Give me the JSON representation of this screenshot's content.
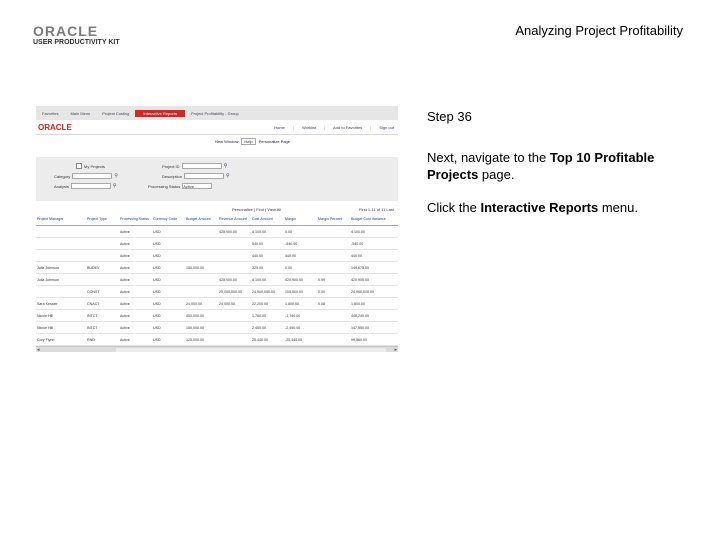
{
  "header": {
    "logo_oracle": "ORACLE",
    "logo_upk": "USER PRODUCTIVITY KIT",
    "title": "Analyzing Project Profitability"
  },
  "screenshot": {
    "nav": [
      "Favorites",
      "Main Menu",
      "Project Costing",
      "Interactive Reports",
      "Project Profitability - Group"
    ],
    "brand": "ORACLE",
    "toplinks": [
      "Home",
      "Worklist",
      "Add to Favorites",
      "Sign out"
    ],
    "ir_row": [
      "New Window",
      "Help",
      "Personalize Page"
    ],
    "filters": {
      "business_unit_label": "My Projects",
      "project_label": "Project ID",
      "category_label": "Category",
      "project_name_label": "Description",
      "analysis_label": "Analysis",
      "processing_status_label": "Processing Status",
      "processing_status_value": "Active"
    },
    "pager": {
      "left": "Personalize | Find | View All",
      "right": "First  1-11 of 11  Last"
    },
    "columns": [
      "Project Manager",
      "Project Type",
      "Processing Status",
      "Currency Code",
      "Budget Amount",
      "Revenue Amount",
      "Cost Amount",
      "Margin",
      "Margin Percent",
      "Budget Cost Variance"
    ],
    "rows": [
      [
        "",
        "",
        "Active",
        "USD",
        "",
        "425,000.00",
        "4,100.00",
        "0.00",
        "",
        "4,100.00"
      ],
      [
        "",
        "",
        "Active",
        "USD",
        "",
        "",
        "540.00",
        "-540.00",
        "",
        "-540.00"
      ],
      [
        "",
        "",
        "Active",
        "USD",
        "",
        "",
        "440.00",
        "440.00",
        "",
        "440.00"
      ],
      [
        "Julia Johnson",
        "BUDEV",
        "Active",
        "USD",
        "150,000.00",
        "",
        "325.00",
        "0.00",
        "",
        "149,675.00"
      ],
      [
        "Julia Johnson",
        "",
        "Active",
        "USD",
        "",
        "425,000.00",
        "4,100.00",
        "420,900.00",
        "0.99",
        "420,900.00"
      ],
      [
        "",
        "CONST",
        "Active",
        "USD",
        "",
        "25,000,000.00",
        "24,900,000.00",
        "100,000.00",
        "0.00",
        "24,900,000.00"
      ],
      [
        "Sara Kessler",
        "CNACT",
        "Active",
        "USD",
        "24,000.00",
        "24,000.00",
        "22,200.00",
        "1,800.00",
        "0.08",
        "1,800.00"
      ],
      [
        "Nicole Hill",
        "INTCT",
        "Active",
        "USD",
        "450,000.00",
        "",
        "1,760.00",
        "-1,760.00",
        "",
        "448,240.00"
      ],
      [
        "Nicole Hill",
        "INTCT",
        "Active",
        "USD",
        "150,000.00",
        "",
        "2,450.00",
        "-2,450.00",
        "",
        "147,550.00"
      ],
      [
        "Cory Flynn",
        "RND",
        "Active",
        "USD",
        "125,000.00",
        "",
        "25,440.00",
        "-25,440.00",
        "",
        "99,560.00"
      ]
    ]
  },
  "step": {
    "label": "Step 36"
  },
  "instruction1": {
    "pre": "Next, navigate to the ",
    "bold": "Top 10 Profitable Projects",
    "post": " page."
  },
  "instruction2": {
    "pre": "Click the ",
    "bold": "Interactive Reports",
    "post": " menu."
  }
}
